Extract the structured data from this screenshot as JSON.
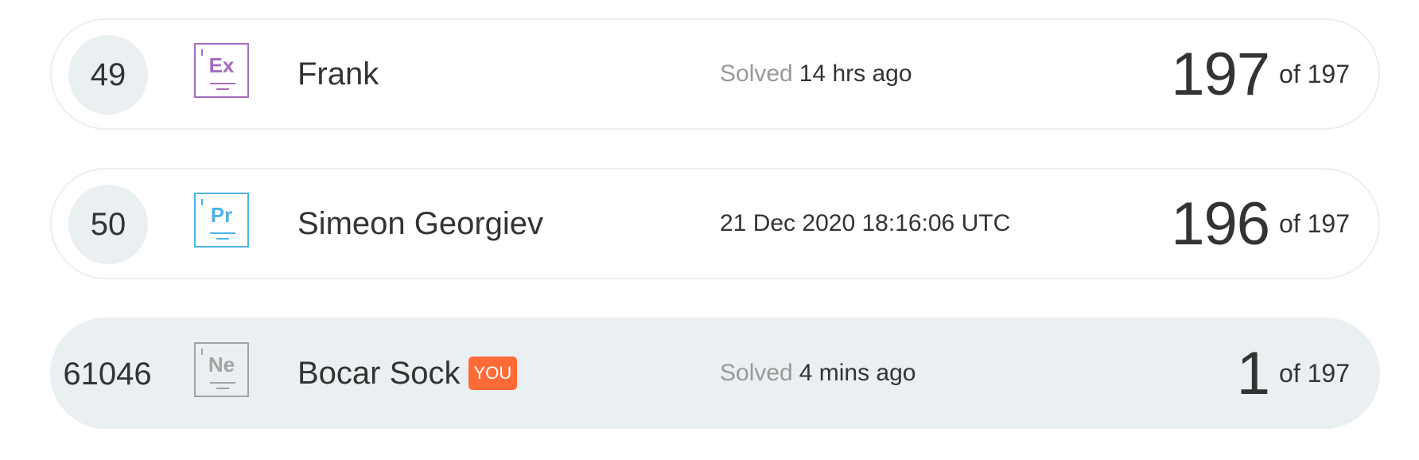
{
  "leaderboard": {
    "rows": [
      {
        "rank": "49",
        "level": {
          "symbol": "Ex",
          "color": "#a66bbf"
        },
        "name": "Frank",
        "status_prefix": "Solved",
        "status_value": "14 hrs ago",
        "score": "197",
        "score_total": "of 197",
        "is_you": false
      },
      {
        "rank": "50",
        "level": {
          "symbol": "Pr",
          "color": "#4db3e6"
        },
        "name": "Simeon Georgiev",
        "status_prefix": "",
        "status_value": "21 Dec 2020 18:16:06 UTC",
        "score": "196",
        "score_total": "of 197",
        "is_you": false
      },
      {
        "rank": "61046",
        "level": {
          "symbol": "Ne",
          "color": "#a3a3a3"
        },
        "name": "Bocar Sock",
        "you_badge": "YOU",
        "status_prefix": "Solved",
        "status_value": "4 mins ago",
        "score": "1",
        "score_total": "of 197",
        "is_you": true
      }
    ]
  },
  "colors": {
    "you_badge_bg": "#ff6a35",
    "current_user_row_bg": "#eaeff1",
    "muted_text": "#999999"
  }
}
